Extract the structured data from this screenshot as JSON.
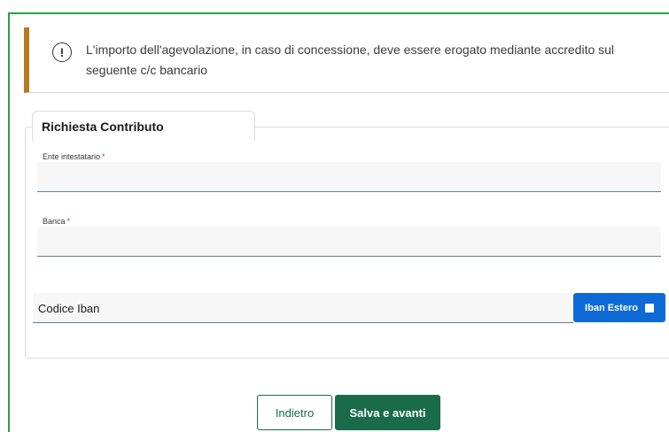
{
  "alert": {
    "icon": "info-circle-icon",
    "accent_color": "#b5791e",
    "line1": "L'importo dell'agevolazione, in caso di concessione, deve essere erogato mediante accredito sul",
    "line2": "seguente c/c bancario"
  },
  "section": {
    "title": "Richiesta Contributo"
  },
  "fields": {
    "ente": {
      "label": "Ente intestatario",
      "required_mark": "*",
      "value": ""
    },
    "banca": {
      "label": "Banca",
      "required_mark": "*",
      "value": ""
    },
    "iban": {
      "label": "Codice Iban",
      "value": ""
    }
  },
  "iban_estero": {
    "label": "Iban Estero",
    "checked": false,
    "color": "#0d6ad6"
  },
  "actions": {
    "back_label": "Indietro",
    "save_label": "Salva e avanti",
    "primary_color": "#1a6b4a"
  }
}
